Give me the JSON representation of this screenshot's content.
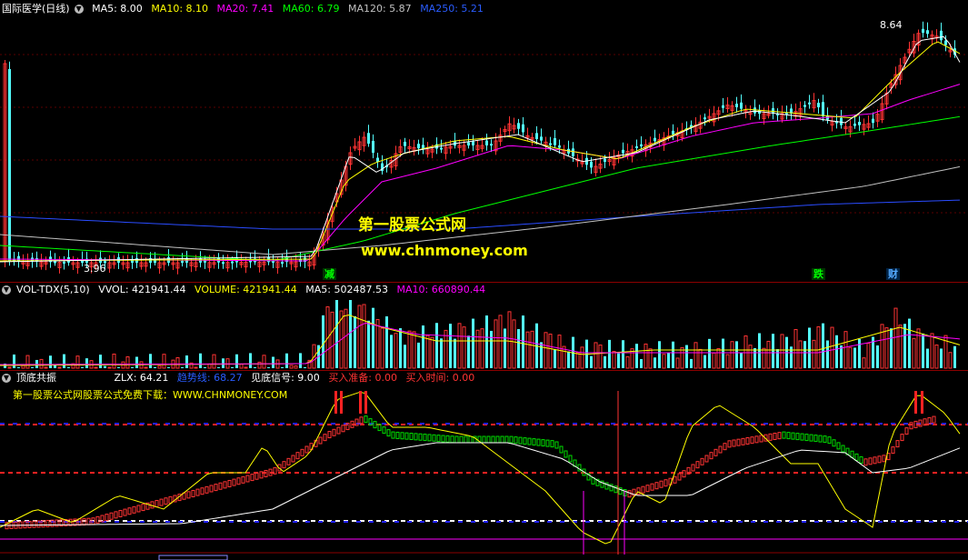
{
  "main": {
    "title": "国际医学(日线)",
    "ma": [
      {
        "label": "MA5: 8.00",
        "color": "#ffffff"
      },
      {
        "label": "MA10: 8.10",
        "color": "#ffff00"
      },
      {
        "label": "MA20: 7.41",
        "color": "#ff00ff"
      },
      {
        "label": "MA60: 6.79",
        "color": "#00ff00"
      },
      {
        "label": "MA120: 5.87",
        "color": "#c0c0c0"
      },
      {
        "label": "MA250: 5.21",
        "color": "#0000ff"
      }
    ],
    "high_label": "8.64",
    "low_label": "3.96",
    "tags": [
      {
        "text": "减",
        "color": "#00ff00"
      },
      {
        "text": "跌",
        "color": "#00ff00"
      },
      {
        "text": "财",
        "color": "#00aaff"
      }
    ]
  },
  "watermark": {
    "line1": "第一股票公式网",
    "line2": "www.chnmoney.com"
  },
  "volume": {
    "title": "VOL-TDX(5,10)",
    "items": [
      {
        "label": "VVOL: 421941.44",
        "color": "#ffffff"
      },
      {
        "label": "VOLUME: 421941.44",
        "color": "#ffff00"
      },
      {
        "label": "MA5: 502487.53",
        "color": "#ffffff"
      },
      {
        "label": "MA10: 660890.44",
        "color": "#ff00ff"
      }
    ]
  },
  "indicator": {
    "title": "顶底共振",
    "items": [
      {
        "label": "ZLX: 64.21",
        "color": "#ffffff"
      },
      {
        "label": "趋势线: 68.27",
        "color": "#0000ff"
      },
      {
        "label": "见底信号: 9.00",
        "color": "#ffffff"
      },
      {
        "label": "买入准备: 0.00",
        "color": "#ff3333"
      },
      {
        "label": "买入时间: 0.00",
        "color": "#ff3333"
      }
    ],
    "note": "第一股票公式网股票公式免费下载：WWW.CHNMONEY.COM"
  }
}
